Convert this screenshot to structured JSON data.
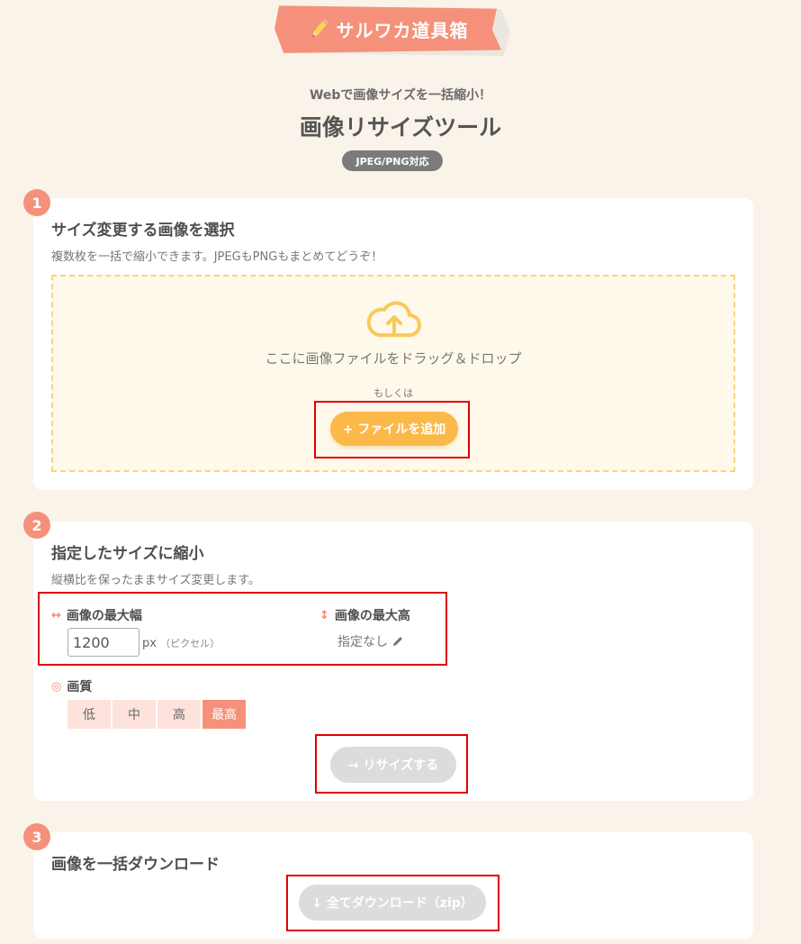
{
  "logo": {
    "text": "サルワカ道具箱"
  },
  "header": {
    "subtitle": "Webで画像サイズを一括縮小！",
    "title": "画像リサイズツール",
    "badge": "JPEG/PNG対応"
  },
  "step1": {
    "number": "1",
    "title": "サイズ変更する画像を選択",
    "description": "複数枚を一括で縮小できます。JPEGもPNGもまとめてどうぞ！",
    "dropzone_text": "ここに画像ファイルをドラッグ＆ドロップ",
    "or_text": "もしくは",
    "add_button": "+ ファイルを追加"
  },
  "step2": {
    "number": "2",
    "title": "指定したサイズに縮小",
    "description": "縦横比を保ったままサイズ変更します。",
    "max_width_label": "画像の最大幅",
    "max_width_value": "1200",
    "unit": "px",
    "unit_note": "（ピクセル）",
    "max_height_label": "画像の最大高",
    "max_height_value": "指定なし",
    "quality_label": "画質",
    "quality_options": [
      "低",
      "中",
      "高",
      "最高"
    ],
    "quality_selected": "最高",
    "resize_button": "→ リサイズする"
  },
  "step3": {
    "number": "3",
    "title": "画像を一括ダウンロード",
    "download_button": "↓ 全てダウンロード（zip）"
  },
  "colors": {
    "background": "#faf3e9",
    "accent": "#f5917a",
    "button_yellow": "#fbb94a",
    "disabled": "#dcdcdc",
    "highlight_box": "#e00000"
  },
  "icons": [
    "pencil-icon",
    "cloud-upload-icon",
    "horizontal-arrows-icon",
    "vertical-arrows-icon",
    "edit-icon",
    "quality-circle-icon"
  ]
}
